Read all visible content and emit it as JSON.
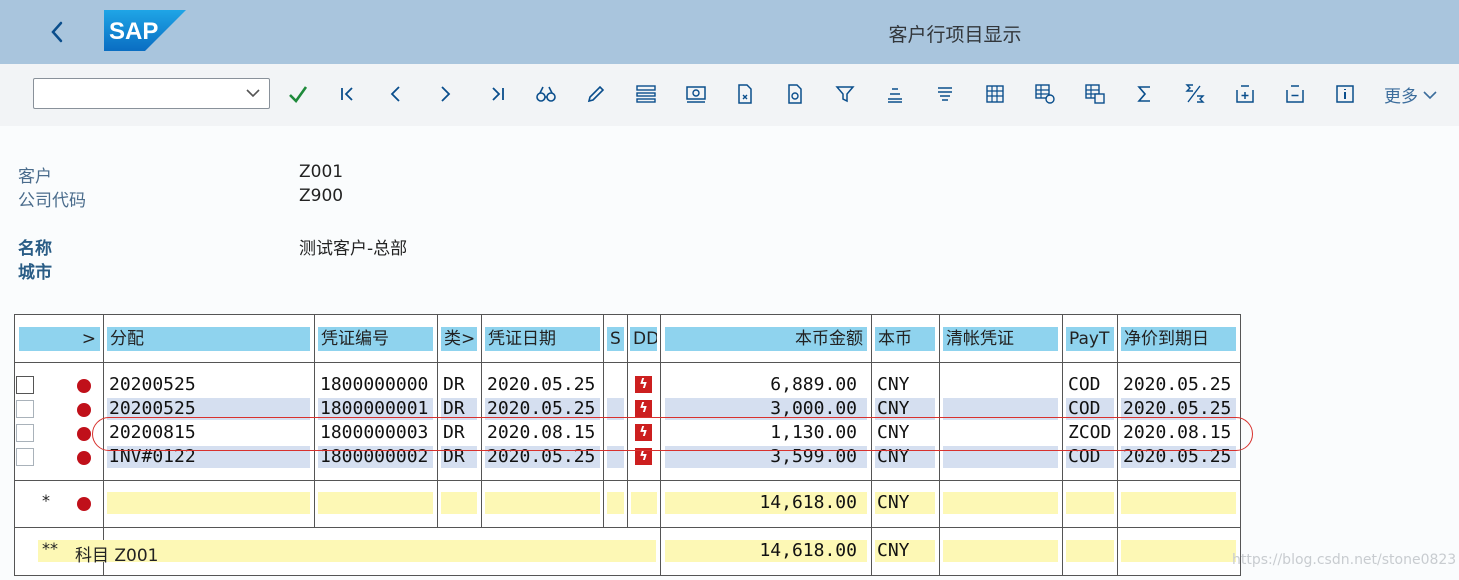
{
  "header": {
    "title": "客户行项目显示"
  },
  "toolbar": {
    "more_label": "更多",
    "layout_value": "",
    "icons": [
      "confirm-icon",
      "first-page-icon",
      "previous-icon",
      "next-icon",
      "last-page-icon",
      "find-icon",
      "edit-icon",
      "select-layout-icon",
      "payment-icon",
      "doc-export-icon",
      "doc-attach-icon",
      "filter-icon",
      "sort-ascending-icon",
      "sort-descending-icon",
      "table-icon",
      "table-settings-icon",
      "table-export-icon",
      "sum-icon",
      "subtotal-icon",
      "expand-icon",
      "collapse-icon",
      "info-icon"
    ]
  },
  "info": {
    "customer_label": "客户",
    "customer_value": "Z001",
    "company_label": "公司代码",
    "company_value": "Z900",
    "name_label": "名称",
    "name_value": "测试客户-总部",
    "city_label": "城市",
    "city_value": ""
  },
  "grid": {
    "columns": {
      "expand": ">",
      "assignment": "分配",
      "doc_no": "凭证编号",
      "type": "类>",
      "doc_date": "凭证日期",
      "s": "S",
      "dd": "DD",
      "amount": "本币金额",
      "currency": "本币",
      "clearing_doc": "清帐凭证",
      "payt": "PayT",
      "due_date": "净价到期日"
    },
    "rows": [
      {
        "assignment": "20200525",
        "doc_no": "1800000000",
        "type": "DR",
        "doc_date": "2020.05.25",
        "amount": "6,889.00",
        "currency": "CNY",
        "clearing_doc": "",
        "payt": "COD",
        "due_date": "2020.05.25"
      },
      {
        "assignment": "20200525",
        "doc_no": "1800000001",
        "type": "DR",
        "doc_date": "2020.05.25",
        "amount": "3,000.00",
        "currency": "CNY",
        "clearing_doc": "",
        "payt": "COD",
        "due_date": "2020.05.25"
      },
      {
        "assignment": "20200815",
        "doc_no": "1800000003",
        "type": "DR",
        "doc_date": "2020.08.15",
        "amount": "1,130.00",
        "currency": "CNY",
        "clearing_doc": "",
        "payt": "ZCOD",
        "due_date": "2020.08.15"
      },
      {
        "assignment": "INV#0122",
        "doc_no": "1800000002",
        "type": "DR",
        "doc_date": "2020.05.25",
        "amount": "3,599.00",
        "currency": "CNY",
        "clearing_doc": "",
        "payt": "COD",
        "due_date": "2020.05.25"
      }
    ],
    "dd_symbol": "ϟ",
    "total": {
      "marker": "*",
      "amount": "14,618.00",
      "currency": "CNY"
    },
    "subtotal": {
      "marker": "**",
      "label": "科目 Z001",
      "amount": "14,618.00",
      "currency": "CNY"
    }
  },
  "watermark": "https://blog.csdn.net/stone0823",
  "colors": {
    "header_bg": "#a9c5dd",
    "column_header": "#8fd3ee",
    "row_alt": "#d5dff0",
    "total_row": "#fdf8b5",
    "status_red": "#c0101a",
    "highlight": "#d8322e"
  }
}
